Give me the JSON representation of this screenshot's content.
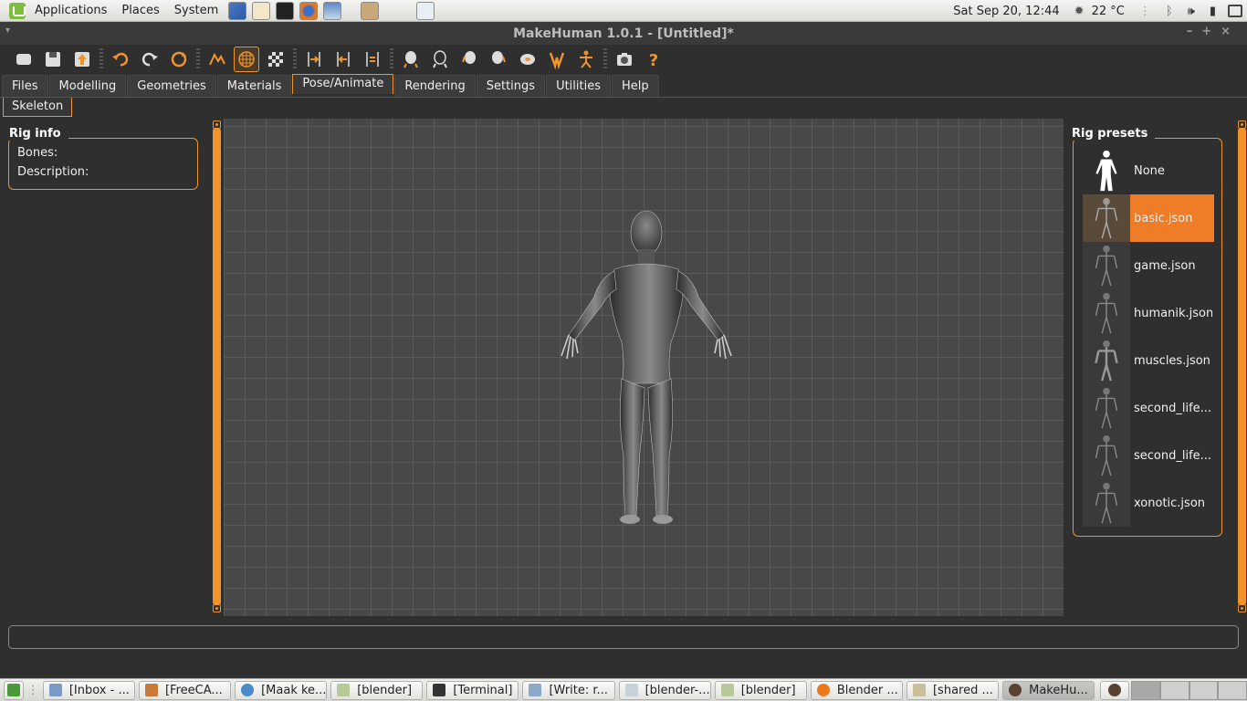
{
  "system_panel": {
    "menus": [
      "Applications",
      "Places",
      "System"
    ],
    "clock": "Sat Sep 20, 12:44",
    "weather": "22 °C"
  },
  "window": {
    "title": "MakeHuman 1.0.1 - [Untitled]*"
  },
  "toolbar": {
    "icons": [
      "new-icon",
      "save-icon",
      "export-icon",
      "undo-icon",
      "redo-icon",
      "reset-icon",
      "smooth-icon",
      "wireframe-icon",
      "background-icon",
      "front-view-icon",
      "back-view-icon",
      "left-view-icon",
      "right-view-icon",
      "top-view-icon",
      "bottom-view-icon",
      "reset-camera-icon",
      "pose-icon",
      "skeleton-icon",
      "screenshot-icon",
      "help-icon"
    ],
    "active": "wireframe-icon"
  },
  "tabs": [
    "Files",
    "Modelling",
    "Geometries",
    "Materials",
    "Pose/Animate",
    "Rendering",
    "Settings",
    "Utilities",
    "Help"
  ],
  "active_tab": "Pose/Animate",
  "subtabs": [
    "Skeleton"
  ],
  "rig_info": {
    "title": "Rig info",
    "bones_label": "Bones:",
    "description_label": "Description:"
  },
  "rig_presets": {
    "title": "Rig presets",
    "items": [
      "None",
      "basic.json",
      "game.json",
      "humanik.json",
      "muscles.json",
      "second_life....",
      "second_life...",
      "xonotic.json"
    ],
    "selected": "basic.json"
  },
  "status_text": "",
  "taskbar": {
    "tasks": [
      "[Inbox - ...",
      "[FreeCA...",
      "[Maak ke...",
      "[blender]",
      "[Terminal]",
      "[Write: r...",
      "[blender-...",
      "[blender]",
      "Blender ...",
      "[shared ...",
      "MakeHu..."
    ],
    "active_task": "MakeHu..."
  },
  "colors": {
    "accent": "#f0932b",
    "selected": "#ef7c26",
    "background": "#2f2f2f",
    "viewport": "#484848"
  }
}
